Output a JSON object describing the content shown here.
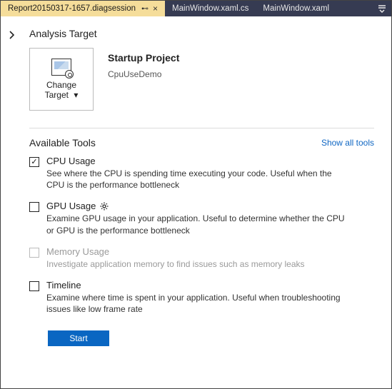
{
  "tabs": {
    "active": "Report20150317-1657.diagsession",
    "others": [
      "MainWindow.xaml.cs",
      "MainWindow.xaml"
    ]
  },
  "analysis_target": {
    "title": "Analysis Target",
    "tile_label_line1": "Change",
    "tile_label_line2": "Target",
    "startup_heading": "Startup Project",
    "startup_value": "CpuUseDemo"
  },
  "tools": {
    "heading": "Available Tools",
    "show_all": "Show all tools",
    "items": [
      {
        "name": "CPU Usage",
        "checked": true,
        "enabled": true,
        "has_gear": false,
        "desc": "See where the CPU is spending time executing your code. Useful when the CPU is the performance bottleneck"
      },
      {
        "name": "GPU Usage",
        "checked": false,
        "enabled": true,
        "has_gear": true,
        "desc": "Examine GPU usage in your application. Useful to determine whether the CPU or GPU is the performance bottleneck"
      },
      {
        "name": "Memory Usage",
        "checked": false,
        "enabled": false,
        "has_gear": false,
        "desc": "Investigate application memory to find issues such as memory leaks"
      },
      {
        "name": "Timeline",
        "checked": false,
        "enabled": true,
        "has_gear": false,
        "desc": "Examine where time is spent in your application. Useful when troubleshooting issues like low frame rate"
      }
    ]
  },
  "start_button": "Start"
}
